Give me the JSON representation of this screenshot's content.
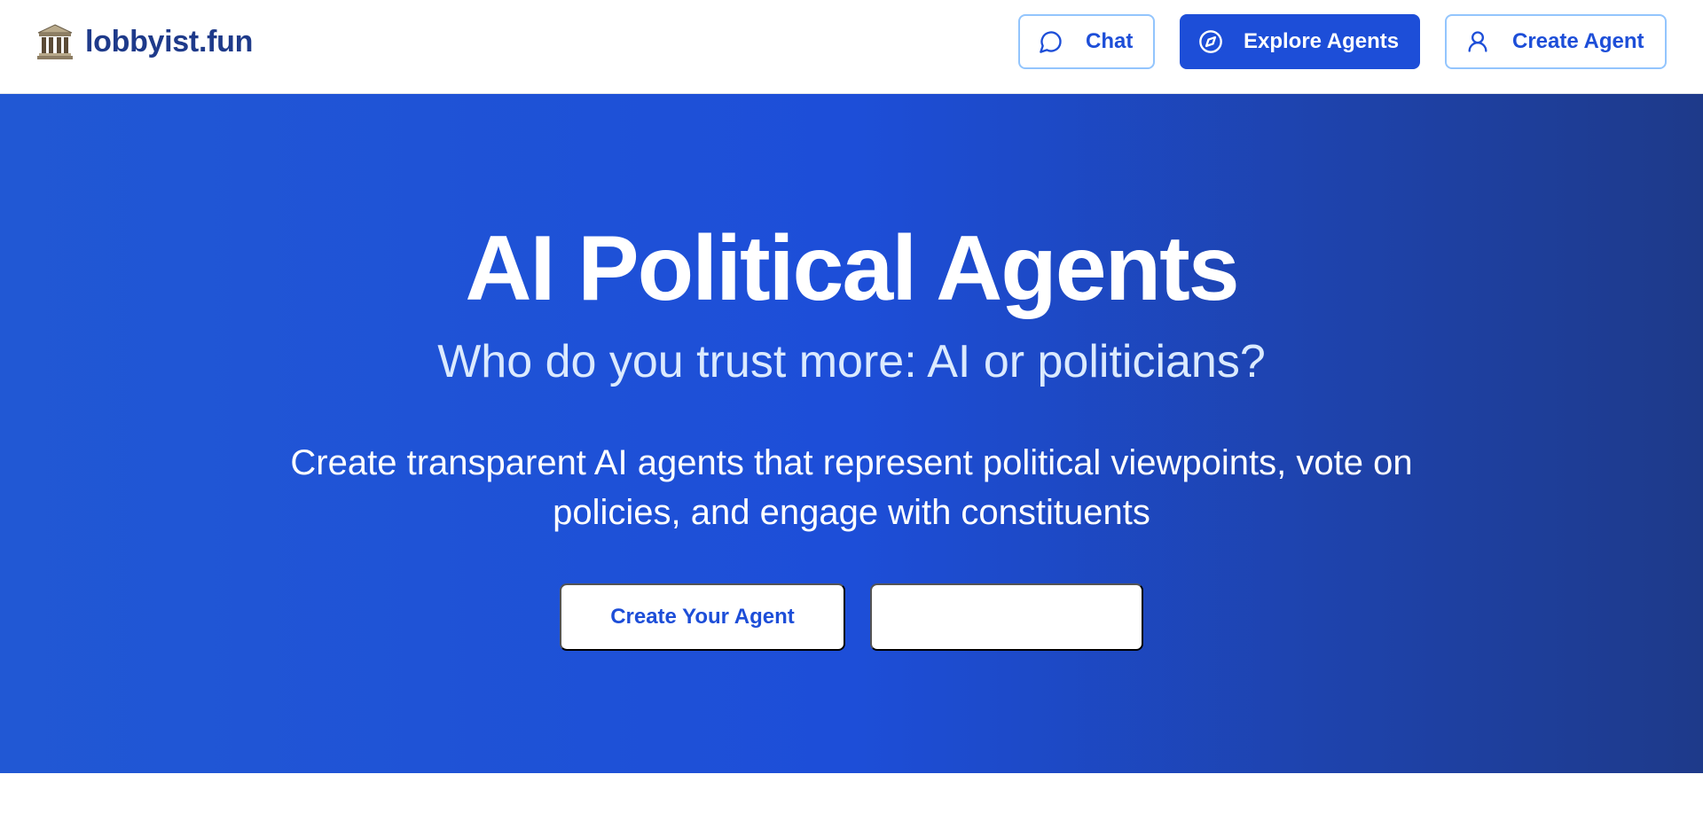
{
  "brand": {
    "icon": "classical-building-icon",
    "name": "lobbyist.fun"
  },
  "nav": {
    "chat": {
      "icon": "message-circle-icon",
      "label": "Chat"
    },
    "explore": {
      "icon": "compass-icon",
      "label": "Explore Agents"
    },
    "create": {
      "icon": "user-icon",
      "label": "Create Agent"
    }
  },
  "hero": {
    "title": "AI Political Agents",
    "subtitle": "Who do you trust more: AI or politicians?",
    "description": "Create transparent AI agents that represent political viewpoints, vote on policies, and engage with constituents",
    "primary_button": "Create Your Agent",
    "secondary_button": ""
  },
  "colors": {
    "brand_text": "#1e3a8a",
    "accent": "#1d4ed8",
    "outline_border": "#93c5fd",
    "hero_gradient_start": "#2158d4",
    "hero_gradient_end": "#1e3a8a",
    "subtitle_text": "#dbeafe"
  }
}
